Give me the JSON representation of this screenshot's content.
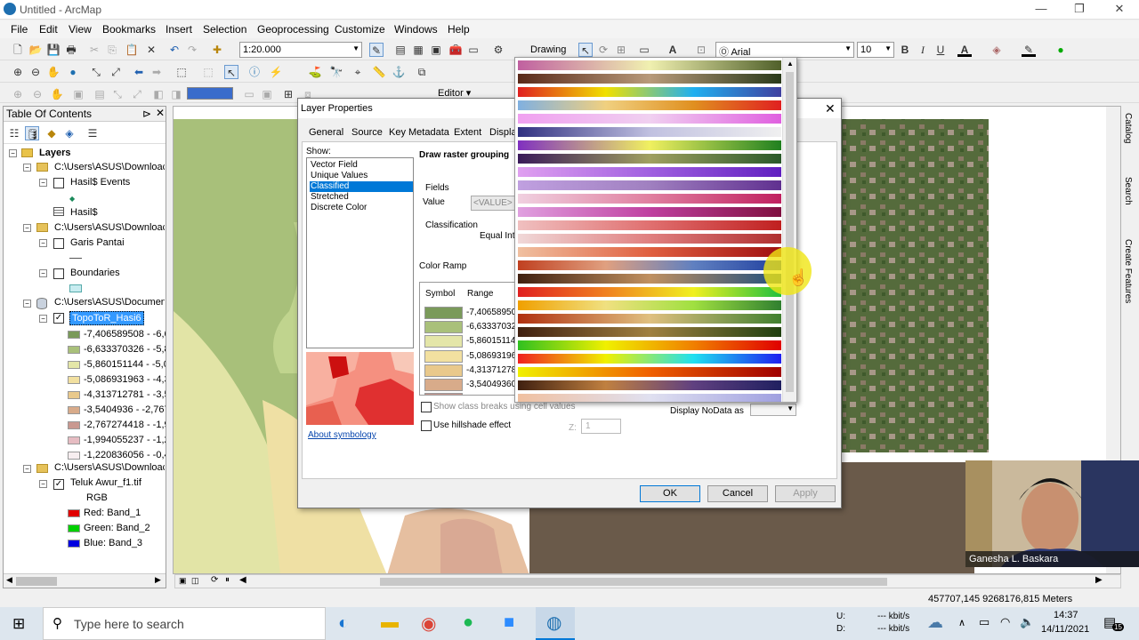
{
  "window": {
    "title": "Untitled - ArcMap"
  },
  "menu": [
    "File",
    "Edit",
    "View",
    "Bookmarks",
    "Insert",
    "Selection",
    "Geoprocessing",
    "Customize",
    "Windows",
    "Help"
  ],
  "toolbar": {
    "scale": "1:20.000",
    "drawing_label": "Drawing",
    "font_name": "Arial",
    "font_size": "10",
    "bold": "B",
    "italic": "I",
    "underline": "U",
    "font_color": "A",
    "editor_label": "Editor"
  },
  "toc": {
    "title": "Table Of Contents",
    "layers_label": "Layers",
    "groups": [
      {
        "path": "C:\\Users\\ASUS\\Downloac",
        "items": [
          "Hasil$ Events",
          "Hasil$"
        ]
      },
      {
        "path": "C:\\Users\\ASUS\\Downloac",
        "items": [
          "Garis Pantai",
          "Boundaries"
        ]
      },
      {
        "path": "C:\\Users\\ASUS\\Documen",
        "items": [
          "TopoToR_Hasi6"
        ]
      },
      {
        "path": "C:\\Users\\ASUS\\Downloac",
        "items": [
          "Teluk Awur_f1.tif"
        ]
      }
    ],
    "classes": [
      {
        "label": "-7,406589508 - -6,6",
        "color": "#7a9a5a"
      },
      {
        "label": "-6,633370326 - -5,8",
        "color": "#a9c07a"
      },
      {
        "label": "-5,860151144 - -5,0",
        "color": "#e4e6a8"
      },
      {
        "label": "-5,086931963 - -4,3",
        "color": "#f2e0a0"
      },
      {
        "label": "-4,313712781 - -3,5",
        "color": "#e9c98c"
      },
      {
        "label": "-3,5404936 - -2,767",
        "color": "#d8ab8a"
      },
      {
        "label": "-2,767274418 - -1,9",
        "color": "#c99890"
      },
      {
        "label": "-1,994055237 - -1,2",
        "color": "#e6bcc2"
      },
      {
        "label": "-1,220836056 - -0,4",
        "color": "#f7eef0"
      }
    ],
    "rgb_label": "RGB",
    "bands": [
      {
        "label": "Red:   Band_1",
        "color": "#e00000"
      },
      {
        "label": "Green: Band_2",
        "color": "#00d000"
      },
      {
        "label": "Blue:  Band_3",
        "color": "#0000e0"
      }
    ]
  },
  "dialog": {
    "title": "Layer Properties",
    "tabs": [
      "General",
      "Source",
      "Key Metadata",
      "Extent",
      "Display"
    ],
    "show_label": "Show:",
    "renderers": [
      "Vector Field",
      "Unique Values",
      "Classified",
      "Stretched",
      "Discrete Color"
    ],
    "selected_renderer": "Classified",
    "heading": "Draw raster grouping",
    "fields_label": "Fields",
    "value_label": "Value",
    "value_field": "<VALUE>",
    "classification_label": "Classification",
    "method": "Equal Int",
    "color_ramp_label": "Color Ramp",
    "symbol_col": "Symbol",
    "range_col": "Range",
    "ranges": [
      "-7,40658950",
      "-6,63337032",
      "-5,86015114",
      "-5,08693196",
      "-4,31371278",
      "-3,54049360",
      "-2,76727441"
    ],
    "show_class_breaks": "Show class breaks using cell values",
    "use_hillshade": "Use hillshade effect",
    "z_label": "Z:",
    "z_value": "1",
    "display_nodata": "Display NoData as",
    "about": "About symbology",
    "ok": "OK",
    "cancel": "Cancel",
    "apply": "Apply"
  },
  "side_tabs": [
    "Catalog",
    "Search",
    "Create Features"
  ],
  "status": {
    "coords": "457707,145  9268176,815 Meters"
  },
  "webcam": {
    "name": "Ganesha L. Baskara"
  },
  "taskbar": {
    "search_placeholder": "Type here to search",
    "net_up_label": "U:",
    "net_down_label": "D:",
    "net_up": "--- kbit/s",
    "net_down": "--- kbit/s",
    "time": "14:37",
    "date": "14/11/2021",
    "notifications": "15"
  },
  "colors": {
    "accent": "#0078d7",
    "selection": "#3399ff"
  }
}
